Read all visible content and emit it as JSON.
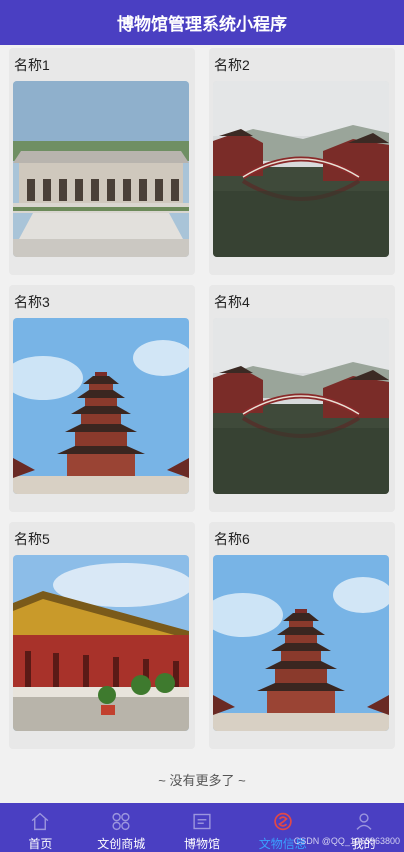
{
  "header": {
    "title": "博物馆管理系统小程序"
  },
  "cards": [
    {
      "title": "名称1",
      "image": "museum-building"
    },
    {
      "title": "名称2",
      "image": "bridge-reflection"
    },
    {
      "title": "名称3",
      "image": "pagoda-tower"
    },
    {
      "title": "名称4",
      "image": "bridge-reflection"
    },
    {
      "title": "名称5",
      "image": "temple-hall"
    },
    {
      "title": "名称6",
      "image": "pagoda-tower"
    }
  ],
  "footer_text": "~ 没有更多了 ~",
  "tabbar": {
    "items": [
      {
        "label": "首页",
        "icon": "home-icon"
      },
      {
        "label": "文创商城",
        "icon": "grid-icon"
      },
      {
        "label": "博物馆",
        "icon": "museum-icon"
      },
      {
        "label": "文物信息",
        "icon": "relic-icon"
      },
      {
        "label": "我的",
        "icon": "user-icon"
      }
    ],
    "active_index": 3
  },
  "watermark": "CSDN @QQ_1063963800",
  "colors": {
    "brand": "#4a3fc2",
    "active_tab": "#3aa0ff"
  }
}
